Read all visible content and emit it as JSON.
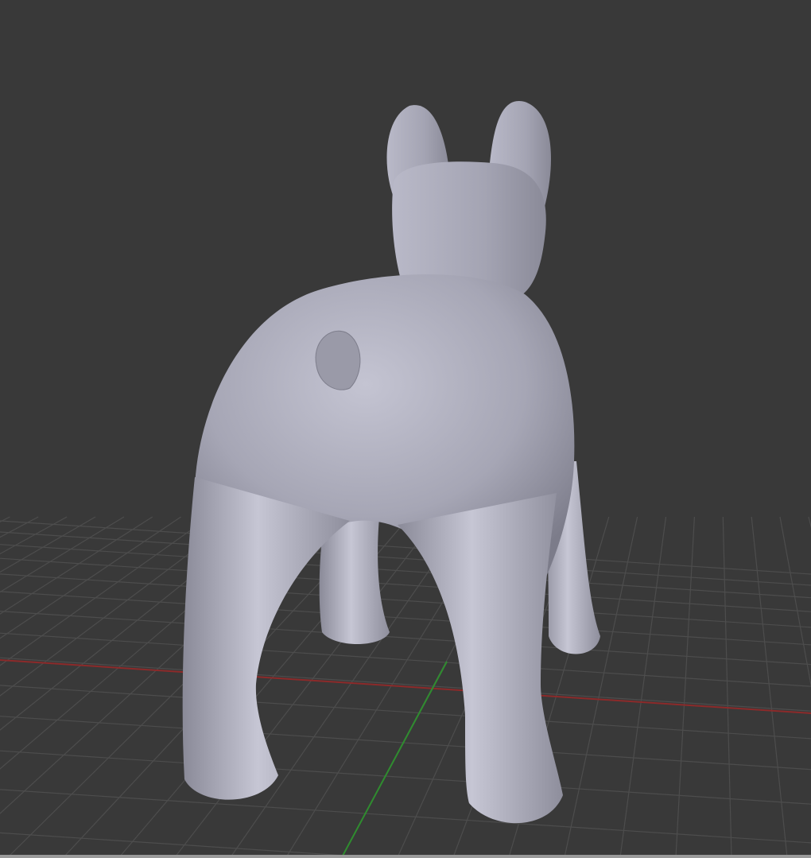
{
  "viewport": {
    "background_color": "#393939",
    "grid_color": "#4d4d4d",
    "x_axis_color": "#8c2a2a",
    "y_axis_color": "#2f8c2f",
    "model_color": "#a8a8b6",
    "model_highlight": "#cfcfdc",
    "model_shadow": "#6e6e7c"
  }
}
